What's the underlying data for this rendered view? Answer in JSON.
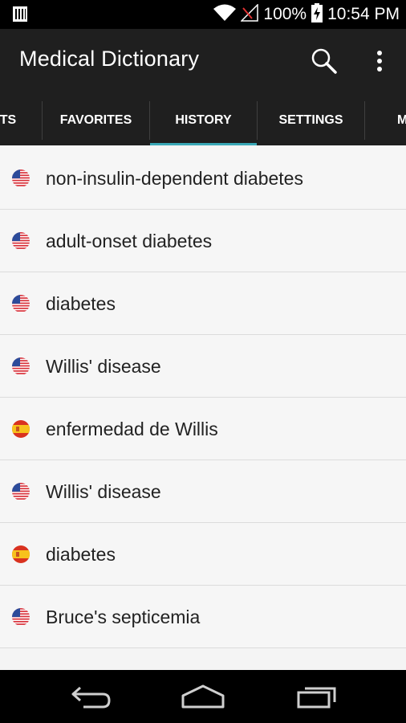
{
  "status_bar": {
    "battery_percent": "100%",
    "time": "10:54 PM",
    "icons": [
      "sim-icon",
      "wifi-icon",
      "no-signal-icon",
      "battery-charging-icon"
    ]
  },
  "app_bar": {
    "title": "Medical Dictionary",
    "icons": [
      "search-icon",
      "overflow-menu-icon"
    ]
  },
  "tabs": [
    {
      "label": "TS",
      "active": false
    },
    {
      "label": "FAVORITES",
      "active": false
    },
    {
      "label": "HISTORY",
      "active": true
    },
    {
      "label": "SETTINGS",
      "active": false
    },
    {
      "label": "M",
      "active": false
    }
  ],
  "history": [
    {
      "term": "non-insulin-dependent diabetes",
      "flag": "us-flag-icon"
    },
    {
      "term": "adult-onset diabetes",
      "flag": "us-flag-icon"
    },
    {
      "term": "diabetes",
      "flag": "us-flag-icon"
    },
    {
      "term": "Willis' disease",
      "flag": "us-flag-icon"
    },
    {
      "term": "enfermedad de Willis",
      "flag": "spain-flag-icon"
    },
    {
      "term": "Willis' disease",
      "flag": "us-flag-icon"
    },
    {
      "term": "diabetes",
      "flag": "spain-flag-icon"
    },
    {
      "term": "Bruce's septicemia",
      "flag": "us-flag-icon"
    }
  ],
  "nav_bar": {
    "icons": [
      "back-icon",
      "home-icon",
      "recent-apps-icon"
    ]
  },
  "colors": {
    "app_bar": "#1f1f1f",
    "tab_indicator": "#3aa8b6",
    "list_background": "#f6f6f6"
  }
}
